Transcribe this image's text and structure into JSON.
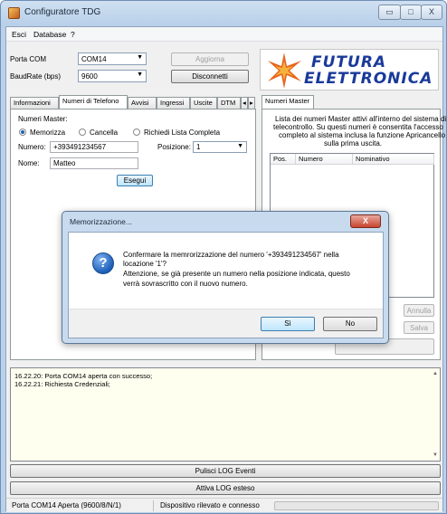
{
  "window": {
    "title": "Configuratore TDG",
    "min_glyph": "▭",
    "max_glyph": "□",
    "close_glyph": "X"
  },
  "menu": {
    "items": [
      "Esci",
      "Database",
      "?"
    ]
  },
  "connection": {
    "port_label": "Porta COM",
    "port_value": "COM14",
    "baud_label": "BaudRate (bps)",
    "baud_value": "9600",
    "update_button": "Aggiorna",
    "disconnect_button": "Disconnetti"
  },
  "logo": {
    "line1": "FUTURA",
    "line2": "ELETTRONICA",
    "accent": "#e8641e",
    "text_color": "#1a3a9a"
  },
  "left_tabs": [
    "Informazioni",
    "Numeri di Telefono",
    "Avvisi",
    "Ingressi",
    "Uscite",
    "DTM",
    "◂",
    "▸"
  ],
  "phone_tab": {
    "section_label": "Numeri Master:",
    "radio_store": "Memorizza",
    "radio_delete": "Cancella",
    "radio_request": "Richiedi Lista Completa",
    "number_label": "Numero:",
    "number_value": "+393491234567",
    "position_label": "Posizione:",
    "position_value": "1",
    "name_label": "Nome:",
    "name_value": "Matteo",
    "execute_button": "Esegui"
  },
  "right_tabs": [
    "Numeri Master"
  ],
  "master_panel": {
    "description_lines": [
      "Lista dei numeri Master attivi all'interno del sistema di",
      "telecontrollo. Su questi numeri è consentita l'accesso",
      "completo al sistema inclusa la funzione Apricancello",
      "sulla prima uscita."
    ],
    "columns": [
      "Pos.",
      "Numero",
      "Nominativo"
    ],
    "cancel_button": "Annulla",
    "save_button": "Salva"
  },
  "log": {
    "lines": [
      "16.22.20: Porta COM14 aperta con successo;",
      "16.22.21: Richiesta Credenziali;"
    ],
    "clear_button": "Pulisci LOG Eventi",
    "enable_button": "Attiva LOG esteso"
  },
  "status": {
    "port_status": "Porta COM14 Aperta (9600/8/N/1)",
    "device_status": "Dispositivo rilevato e connesso"
  },
  "dialog": {
    "title": "Memorizzazione...",
    "close_glyph": "X",
    "icon": "?",
    "line1": "Confermare la memrorizzazione del numero '+393491234567' nella",
    "line2": "locazione '1'?",
    "line3": "Attenzione, se già presente un numero nella posizione indicata, questo",
    "line4": "verrà sovrascritto con il nuovo numero.",
    "yes_button": "Sì",
    "no_button": "No"
  }
}
